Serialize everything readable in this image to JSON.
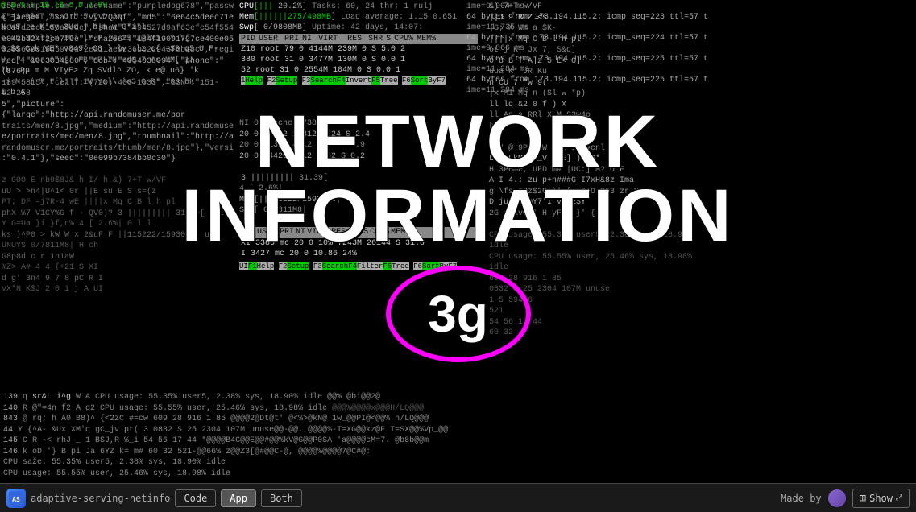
{
  "app": {
    "icon_label": "AS",
    "name": "adaptive-serving-netinfo",
    "tabs": [
      {
        "label": "Code",
        "active": false
      },
      {
        "label": "App",
        "active": true
      },
      {
        "label": "Both",
        "active": false
      }
    ],
    "made_by_text": "Made by",
    "show_label": "Show"
  },
  "network_title": {
    "line1": "NETWORK",
    "line2": "INFORMATION"
  },
  "signal": {
    "label": "3g"
  },
  "terminal": {
    "col1_lines": [
      "15@example.com\",\"username\":\"purpledog678\",\"password",
      "{\"jaeger\",\"salt\":\"vyV2Qpqf\",\"md5\":\"6e64c5deec71e5f",
      "b01fd2ccb150a8ede\",\"sha1\":\"494527d9af63efc54f554e6e",
      "e043bd24f2cb7f9e\",\"sha256\":\"184f19091727ce400e05338",
      "0205659315d5979af2ea11ae9e36b32d943feba8c\",\"registe",
      "red\":\"1063034280\",\"dob\":\"4954038094\",\"phone\":\"(876)-",
      "189-5815\",\"cell\":\"(720)-400-1633\",\"SSN\":\"151-62-258",
      "5\",\"picture\":{\"large\":\"http://api.randomuser.me/por",
      "traits/men/8.jpg\",\"medium\":\"http://api.randomuser.m",
      "e/portraits/med/men/8.jpg\",\"thumbnail\":\"http://api.",
      "randomuser.me/portraits/thumb/men/8.jpg\"},\"version\"",
      ":\"0.4.1\"},\"seed\":\"0e099b7384bb0c30\"}"
    ],
    "col2_lines": [
      "z  GOO E nb9$8J& h  I/   h",
      "uU >  >n4|U^1< 0r",
      "PT; DF =j7R-4 wE",
      "phX %7  V1CY%G f  - QV0)?",
      "Y  G=Ua     }i      }f,n%",
      "ks_)^P0  >   kW  W x 2&uF F",
      "UNUYS",
      "G8p8d  c      r  1n1aW",
      "%Z>  A#  4   4   {+21 S",
      "d g'  3n4  9   7  8 pC R",
      "vX*N  K$J  2    0   i  j  A"
    ],
    "htop_lines": [
      "CPU[||| 20.2%]",
      "Mem[||||||275/498MB]",
      "Swp[       0/9808MB]"
    ],
    "tasks_line": "Tasks: 60, 24 thr; 1 run",
    "load_line": "Load average: 1.15 0.651",
    "uptime_line": "Uptime: 42 days, 14:07:",
    "pid_header": [
      "PID",
      "USER",
      "PRI",
      "NI",
      "VIRT",
      "RES",
      "SHR",
      "S",
      "CPU%",
      "MEM%"
    ],
    "pid_rows": [
      [
        "210",
        "root",
        "79",
        "0",
        "4144M",
        "239M",
        "0",
        "S",
        "5.0",
        "2"
      ],
      [
        "380",
        "root",
        "31",
        "0",
        "3477M",
        "130M",
        "0",
        "S",
        "0.0",
        "1"
      ],
      [
        "52",
        "root",
        "31",
        "0",
        "2554M",
        "104M",
        "0",
        "S",
        "0.0",
        "1"
      ],
      [
        "3386",
        "mc",
        "20",
        "0",
        "10%",
        "7243M",
        "26144",
        "S",
        "31.8",
        ""
      ],
      [
        "3427",
        "mc",
        "20",
        "0",
        "10.86",
        "24%",
        "",
        "",
        "",
        ""
      ]
    ],
    "ping_lines": [
      "64 bytes from 173.194.115.2: icmp_seq=223 ttl=57 t",
      "ime=9.904 ms",
      "64 bytes from 173.194.115.2: icmp_seq=224 ttl=57 t",
      "ime=11.735 ms",
      "64 bytes from 173.194.115.2: icmp_seq=225 ttl=57 t",
      "ime=9.866 ms",
      "64 bytes from 173.194.115.2: icmp_seq=225 ttl=57 t",
      "ime=11.284 ms"
    ],
    "bottom_lines": [
      "139                           q         sr&L  i^g         W  A  CPU usage: 55.35% user5, 2.38% sys, 18.90% idle",
      "140                   R  @\"=4n  f2              A  g2   CPU usage: 55.55% user, 25.46% sys, 18.98% idle",
      "843            @   rq;  h  A0 B8)^  {<2zC  #=cw      1   5    594           6",
      "44         Y  {^A- &Ux XM'q  gC_jv  pt(          3",
      "145        C  R -<  rhJ _ 1   BSJ,R  %_i                 54    56  17   44",
      "146           k  oD  '}  B  pi  Ja  6YZ k=   m#               60        32"
    ]
  },
  "colors": {
    "background": "#000000",
    "terminal_green": "#00cc00",
    "terminal_cyan": "#00cccc",
    "signal_circle": "#ff00ff",
    "title_white": "#ffffff",
    "bar_bg": "#1a1a1a",
    "active_tab_bg": "#555555"
  }
}
